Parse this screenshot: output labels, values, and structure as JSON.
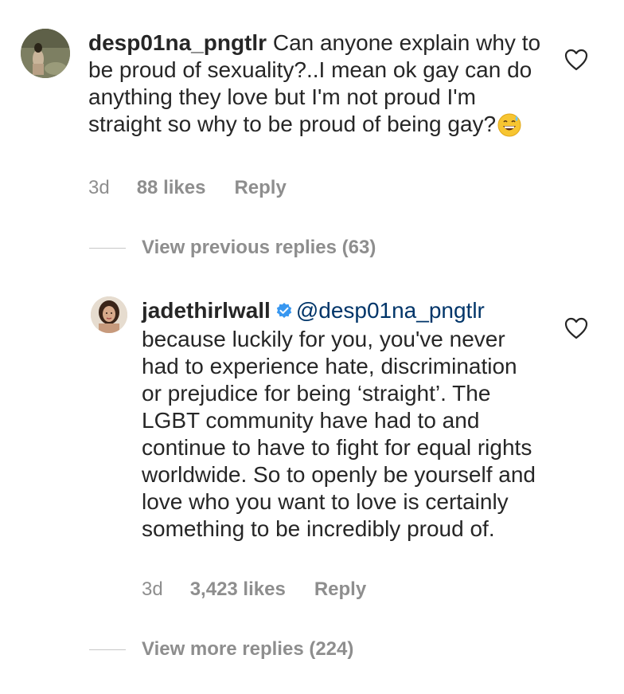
{
  "comments": [
    {
      "username": "desp01na_pngtlr",
      "text": "Can anyone explain why to be proud of sexuality?..I mean ok gay can do anything they love but I'm not proud I'm straight so why to be proud of being gay?",
      "emoji": "grinning-sweat-emoji",
      "time": "3d",
      "likes": "88 likes",
      "reply_label": "Reply"
    },
    {
      "username": "jadethirlwall",
      "verified": true,
      "mention": "@desp01na_pngtlr",
      "text": "because luckily for you, you've never had to experience hate, discrimination or prejudice for being ‘straight’. The LGBT community have had to and continue to have to fight for equal rights worldwide. So to openly be yourself and love who you want to love is certainly something to be incredibly proud of.",
      "time": "3d",
      "likes": "3,423 likes",
      "reply_label": "Reply"
    }
  ],
  "view_previous_replies": "View previous replies (63)",
  "view_more_replies": "View more replies (224)",
  "icons": {
    "like": "heart-outline-icon",
    "verified": "verified-badge-icon"
  },
  "colors": {
    "text": "#262626",
    "muted": "#8e8e8e",
    "mention": "#003569",
    "verified": "#3897f0"
  }
}
